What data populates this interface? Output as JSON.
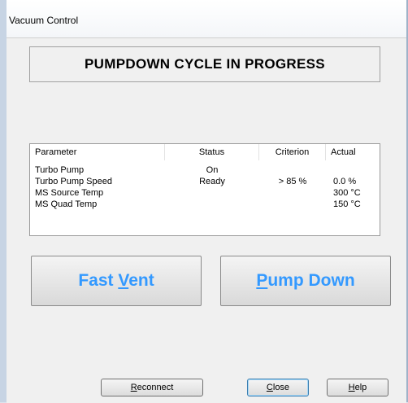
{
  "window": {
    "title": "Vacuum Control"
  },
  "banner": {
    "text": "PUMPDOWN CYCLE IN PROGRESS"
  },
  "table": {
    "headers": [
      "Parameter",
      "Status",
      "Criterion",
      "Actual"
    ],
    "rows": [
      {
        "parameter": "Turbo Pump",
        "status": "On",
        "criterion": "",
        "actual": ""
      },
      {
        "parameter": "Turbo Pump Speed",
        "status": "Ready",
        "criterion": "> 85 %",
        "actual": "0.0 %"
      },
      {
        "parameter": "MS Source Temp",
        "status": "",
        "criterion": "",
        "actual": "300 °C"
      },
      {
        "parameter": "MS Quad Temp",
        "status": "",
        "criterion": "",
        "actual": "150 °C"
      }
    ]
  },
  "buttons": {
    "fast_vent": {
      "pre": "Fast ",
      "mnemonic": "V",
      "post": "ent"
    },
    "pump_down": {
      "pre": "",
      "mnemonic": "P",
      "post": "ump Down"
    },
    "reconnect": {
      "pre": "",
      "mnemonic": "R",
      "post": "econnect"
    },
    "close": {
      "pre": "",
      "mnemonic": "C",
      "post": "lose"
    },
    "help": {
      "pre": "",
      "mnemonic": "H",
      "post": "elp"
    }
  }
}
